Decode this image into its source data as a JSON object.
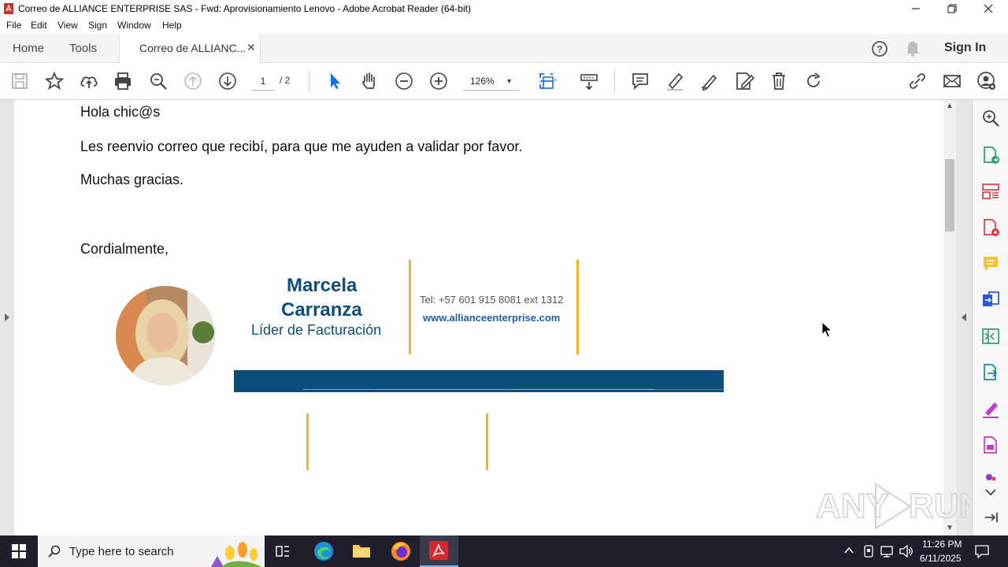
{
  "window": {
    "title": "Correo de ALLIANCE ENTERPRISE SAS - Fwd: Aprovisionamiento Lenovo - Adobe Acrobat Reader (64-bit)"
  },
  "menu": [
    "File",
    "Edit",
    "View",
    "Sign",
    "Window",
    "Help"
  ],
  "tabs": {
    "home": "Home",
    "tools": "Tools",
    "document": "Correo de ALLIANC...",
    "sign_in": "Sign In"
  },
  "toolbar": {
    "current_page": "1",
    "total_pages": "/ 2",
    "zoom": "126%"
  },
  "document": {
    "greeting": "Hola chic@s",
    "body": "Les reenvio correo que recibí, para que me ayuden a validar por favor.",
    "thanks": "Muchas gracias.",
    "closing": "Cordialmente,",
    "signature": {
      "first_name": "Marcela",
      "last_name": "Carranza",
      "role": "Líder de Facturación",
      "phone": "Tel: +57 601 915 8081 ext 1312",
      "website": "www.allianceenterprise.com",
      "brand_color": "#0d4d79",
      "accent_color": "#f0b429"
    }
  },
  "taskbar": {
    "search_placeholder": "Type here to search",
    "time": "11:26 PM",
    "date": "6/11/2025"
  },
  "colors": {
    "acrobat_red": "#d7282d",
    "select_blue": "#1473e6",
    "taskbar_bg": "#1f1f2e"
  }
}
